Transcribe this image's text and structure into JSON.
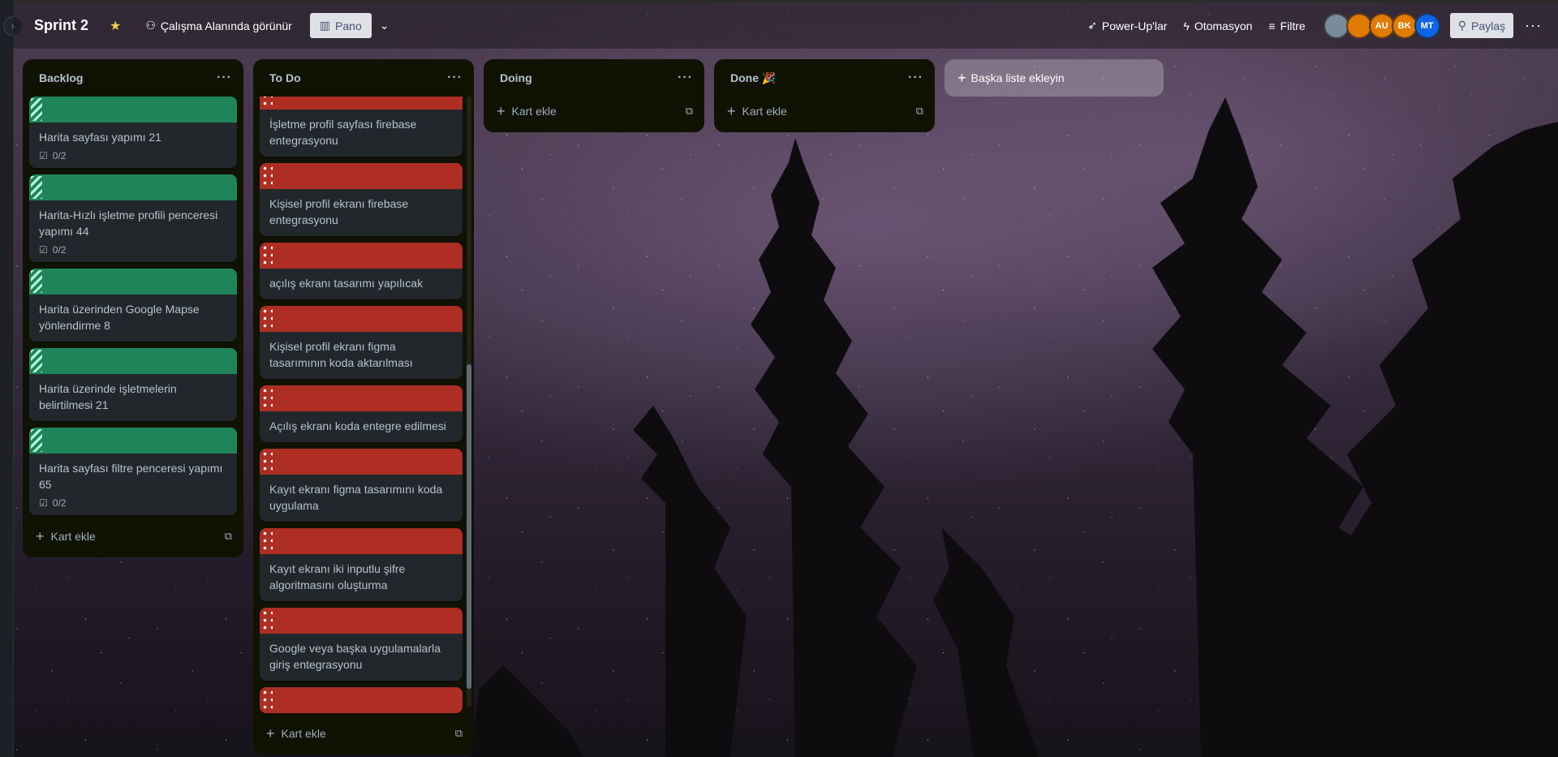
{
  "board": {
    "title": "Sprint 2",
    "visibility": "Çalışma Alanında görünür",
    "view": "Pano"
  },
  "header_right": {
    "powerups": "Power-Up'lar",
    "automation": "Otomasyon",
    "filter": "Filtre",
    "share": "Paylaş",
    "avatars": [
      {
        "initials": "",
        "color": "#7a8b99"
      },
      {
        "initials": "",
        "color": "#e07b00"
      },
      {
        "initials": "AU",
        "color": "#e07b00"
      },
      {
        "initials": "BK",
        "color": "#e07b00"
      },
      {
        "initials": "MT",
        "color": "#0c66e4"
      }
    ]
  },
  "lists": {
    "backlog": {
      "title": "Backlog",
      "cards": [
        {
          "title": "Harita sayfası yapımı 21",
          "badge": "0/2"
        },
        {
          "title": "Harita-Hızlı işletme profili penceresi yapımı 44",
          "badge": "0/2"
        },
        {
          "title": "Harita üzerinden Google Mapse yönlendirme 8"
        },
        {
          "title": "Harita üzerinde işletmelerin belirtilmesi 21"
        },
        {
          "title": "Harita sayfası filtre penceresi yapımı 65",
          "badge": "0/2"
        }
      ],
      "add_card": "Kart ekle"
    },
    "todo": {
      "title": "To Do",
      "cards": [
        {
          "title": "İşletme profil sayfası firebase entegrasyonu"
        },
        {
          "title": "Kişisel profil ekranı firebase entegrasyonu"
        },
        {
          "title": "açılış ekranı tasarımı yapılıcak"
        },
        {
          "title": "Kişisel profil ekranı figma tasarımının koda aktarılması"
        },
        {
          "title": "Açılış ekranı koda entegre edilmesi"
        },
        {
          "title": "Kayıt ekranı figma tasarımını koda uygulama"
        },
        {
          "title": "Kayıt ekranı iki inputlu şifre algoritmasını oluşturma"
        },
        {
          "title": "Google veya başka uygulamalarla giriş entegrasyonu"
        }
      ],
      "add_card": "Kart ekle"
    },
    "doing": {
      "title": "Doing",
      "add_card": "Kart ekle"
    },
    "done": {
      "title": "Done 🎉",
      "add_card": "Kart ekle"
    }
  },
  "add_list": "Başka liste ekleyin"
}
